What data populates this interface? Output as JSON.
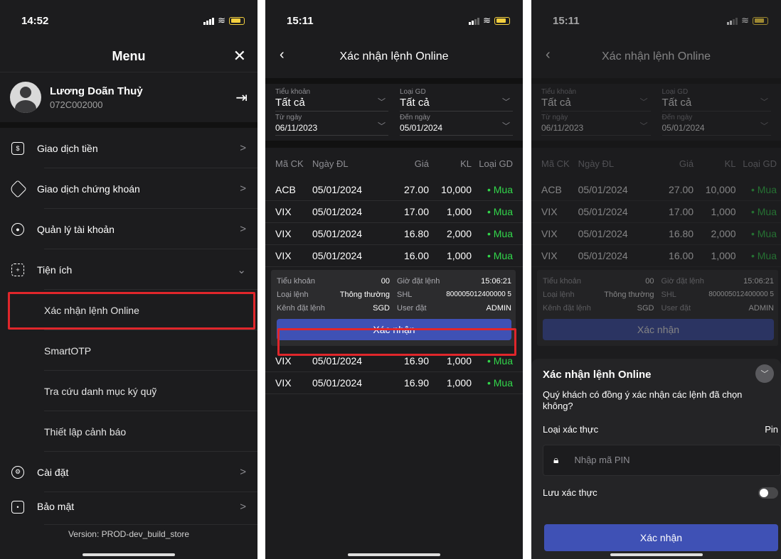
{
  "menu_screen": {
    "time": "14:52",
    "title": "Menu",
    "close_icon": "close-icon",
    "user": {
      "name": "Lương Doãn Thuỷ",
      "account": "072C002000"
    },
    "items": [
      {
        "label": "Giao dịch tiền",
        "icon": "cash-transaction-icon",
        "chevron": ">"
      },
      {
        "label": "Giao dịch chứng khoán",
        "icon": "tag-icon",
        "chevron": ">"
      },
      {
        "label": "Quản lý tài khoản",
        "icon": "account-icon",
        "chevron": ">"
      },
      {
        "label": "Tiện ích",
        "icon": "utilities-icon",
        "chevron": "⌄"
      }
    ],
    "sub_items": [
      "Xác nhận lệnh Online",
      "SmartOTP",
      "Tra cứu danh mục ký quỹ",
      "Thiết lập cảnh báo"
    ],
    "bottom_items": [
      {
        "label": "Cài đặt",
        "icon": "settings-icon",
        "chevron": ">"
      },
      {
        "label": "Bảo mật",
        "icon": "lock-icon",
        "chevron": ">"
      }
    ],
    "version": "Version: PROD-dev_build_store"
  },
  "confirm_screen": {
    "time": "15:11",
    "title": "Xác nhận lệnh Online",
    "filters": {
      "sub_account_label": "Tiểu khoản",
      "sub_account_value": "Tất cả",
      "type_label": "Loại GD",
      "type_value": "Tất cả",
      "from_label": "Từ ngày",
      "from_value": "06/11/2023",
      "to_label": "Đến ngày",
      "to_value": "05/01/2024"
    },
    "columns": [
      "Mã CK",
      "Ngày ĐL",
      "Giá",
      "KL",
      "Loại GD"
    ],
    "rows_top": [
      [
        "ACB",
        "05/01/2024",
        "27.00",
        "10,000",
        "• Mua"
      ],
      [
        "VIX",
        "05/01/2024",
        "17.00",
        "1,000",
        "• Mua"
      ],
      [
        "VIX",
        "05/01/2024",
        "16.80",
        "2,000",
        "• Mua"
      ],
      [
        "VIX",
        "05/01/2024",
        "16.00",
        "1,000",
        "• Mua"
      ]
    ],
    "detail": {
      "sub_account_k": "Tiểu khoản",
      "sub_account_v": "00",
      "order_time_k": "Giờ đặt lệnh",
      "order_time_v": "15:06:21",
      "order_type_k": "Loại lệnh",
      "order_type_v": "Thông thường",
      "shl_k": "SHL",
      "shl_v": "800005012400000 5",
      "channel_k": "Kênh đặt lệnh",
      "channel_v": "SGD",
      "user_k": "User đặt",
      "user_v": "ADMIN"
    },
    "confirm_button": "Xác nhận",
    "rows_bottom": [
      [
        "VIX",
        "05/01/2024",
        "16.90",
        "1,000",
        "• Mua"
      ],
      [
        "VIX",
        "05/01/2024",
        "16.90",
        "1,000",
        "• Mua"
      ]
    ]
  },
  "sheet_screen": {
    "time": "15:11",
    "title": "Xác nhận lệnh Online",
    "sheet_title": "Xác nhận lệnh Online",
    "question": "Quý khách có đồng ý xác nhận các lệnh đã chọn không?",
    "auth_type_label": "Loại xác thực",
    "auth_type_value": "Pin",
    "pin_placeholder": "Nhập mã PIN",
    "save_auth_label": "Lưu xác thực",
    "confirm_button": "Xác nhận",
    "detail_shl_v": "800005012400000 5"
  },
  "colors": {
    "accent": "#3f51b5",
    "buy": "#32d74b",
    "highlight": "#e0262b",
    "bg": "#1c1c1e"
  }
}
